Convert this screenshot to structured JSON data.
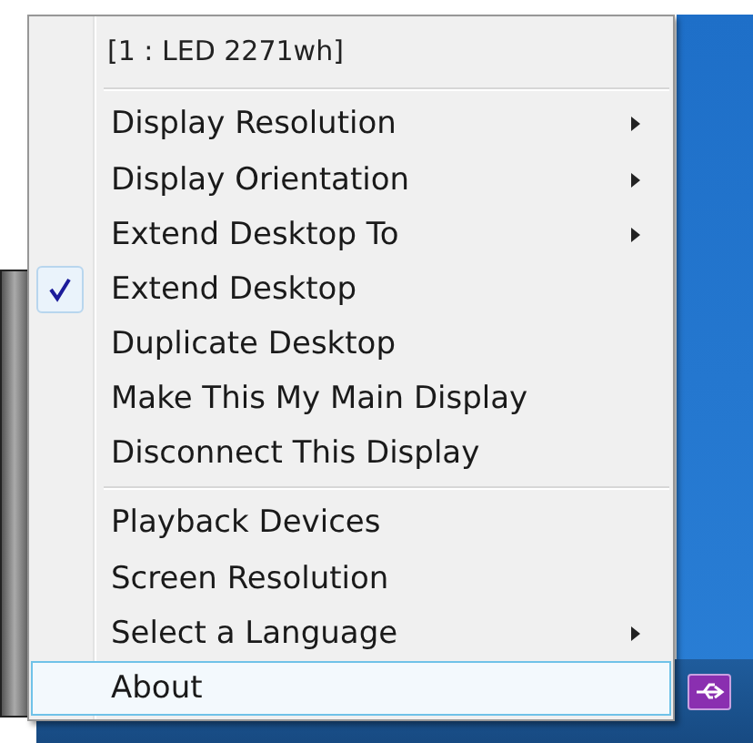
{
  "menu": {
    "items": [
      {
        "kind": "header",
        "label": "[1 : LED 2271wh]"
      },
      {
        "kind": "separator"
      },
      {
        "kind": "item",
        "label": "Display Resolution",
        "submenu": true,
        "checked": false,
        "selected": false
      },
      {
        "kind": "item",
        "label": "Display Orientation",
        "submenu": true,
        "checked": false,
        "selected": false
      },
      {
        "kind": "item",
        "label": "Extend Desktop To",
        "submenu": true,
        "checked": false,
        "selected": false
      },
      {
        "kind": "item",
        "label": "Extend Desktop",
        "submenu": false,
        "checked": true,
        "selected": false
      },
      {
        "kind": "item",
        "label": "Duplicate Desktop",
        "submenu": false,
        "checked": false,
        "selected": false
      },
      {
        "kind": "item",
        "label": "Make This My Main Display",
        "submenu": false,
        "checked": false,
        "selected": false
      },
      {
        "kind": "item",
        "label": "Disconnect This Display",
        "submenu": false,
        "checked": false,
        "selected": false
      },
      {
        "kind": "separator"
      },
      {
        "kind": "item",
        "label": "Playback Devices",
        "submenu": false,
        "checked": false,
        "selected": false
      },
      {
        "kind": "item",
        "label": "Screen Resolution",
        "submenu": false,
        "checked": false,
        "selected": false
      },
      {
        "kind": "item",
        "label": "Select a Language",
        "submenu": true,
        "checked": false,
        "selected": false
      },
      {
        "kind": "item",
        "label": "About",
        "submenu": false,
        "checked": false,
        "selected": true
      }
    ]
  }
}
